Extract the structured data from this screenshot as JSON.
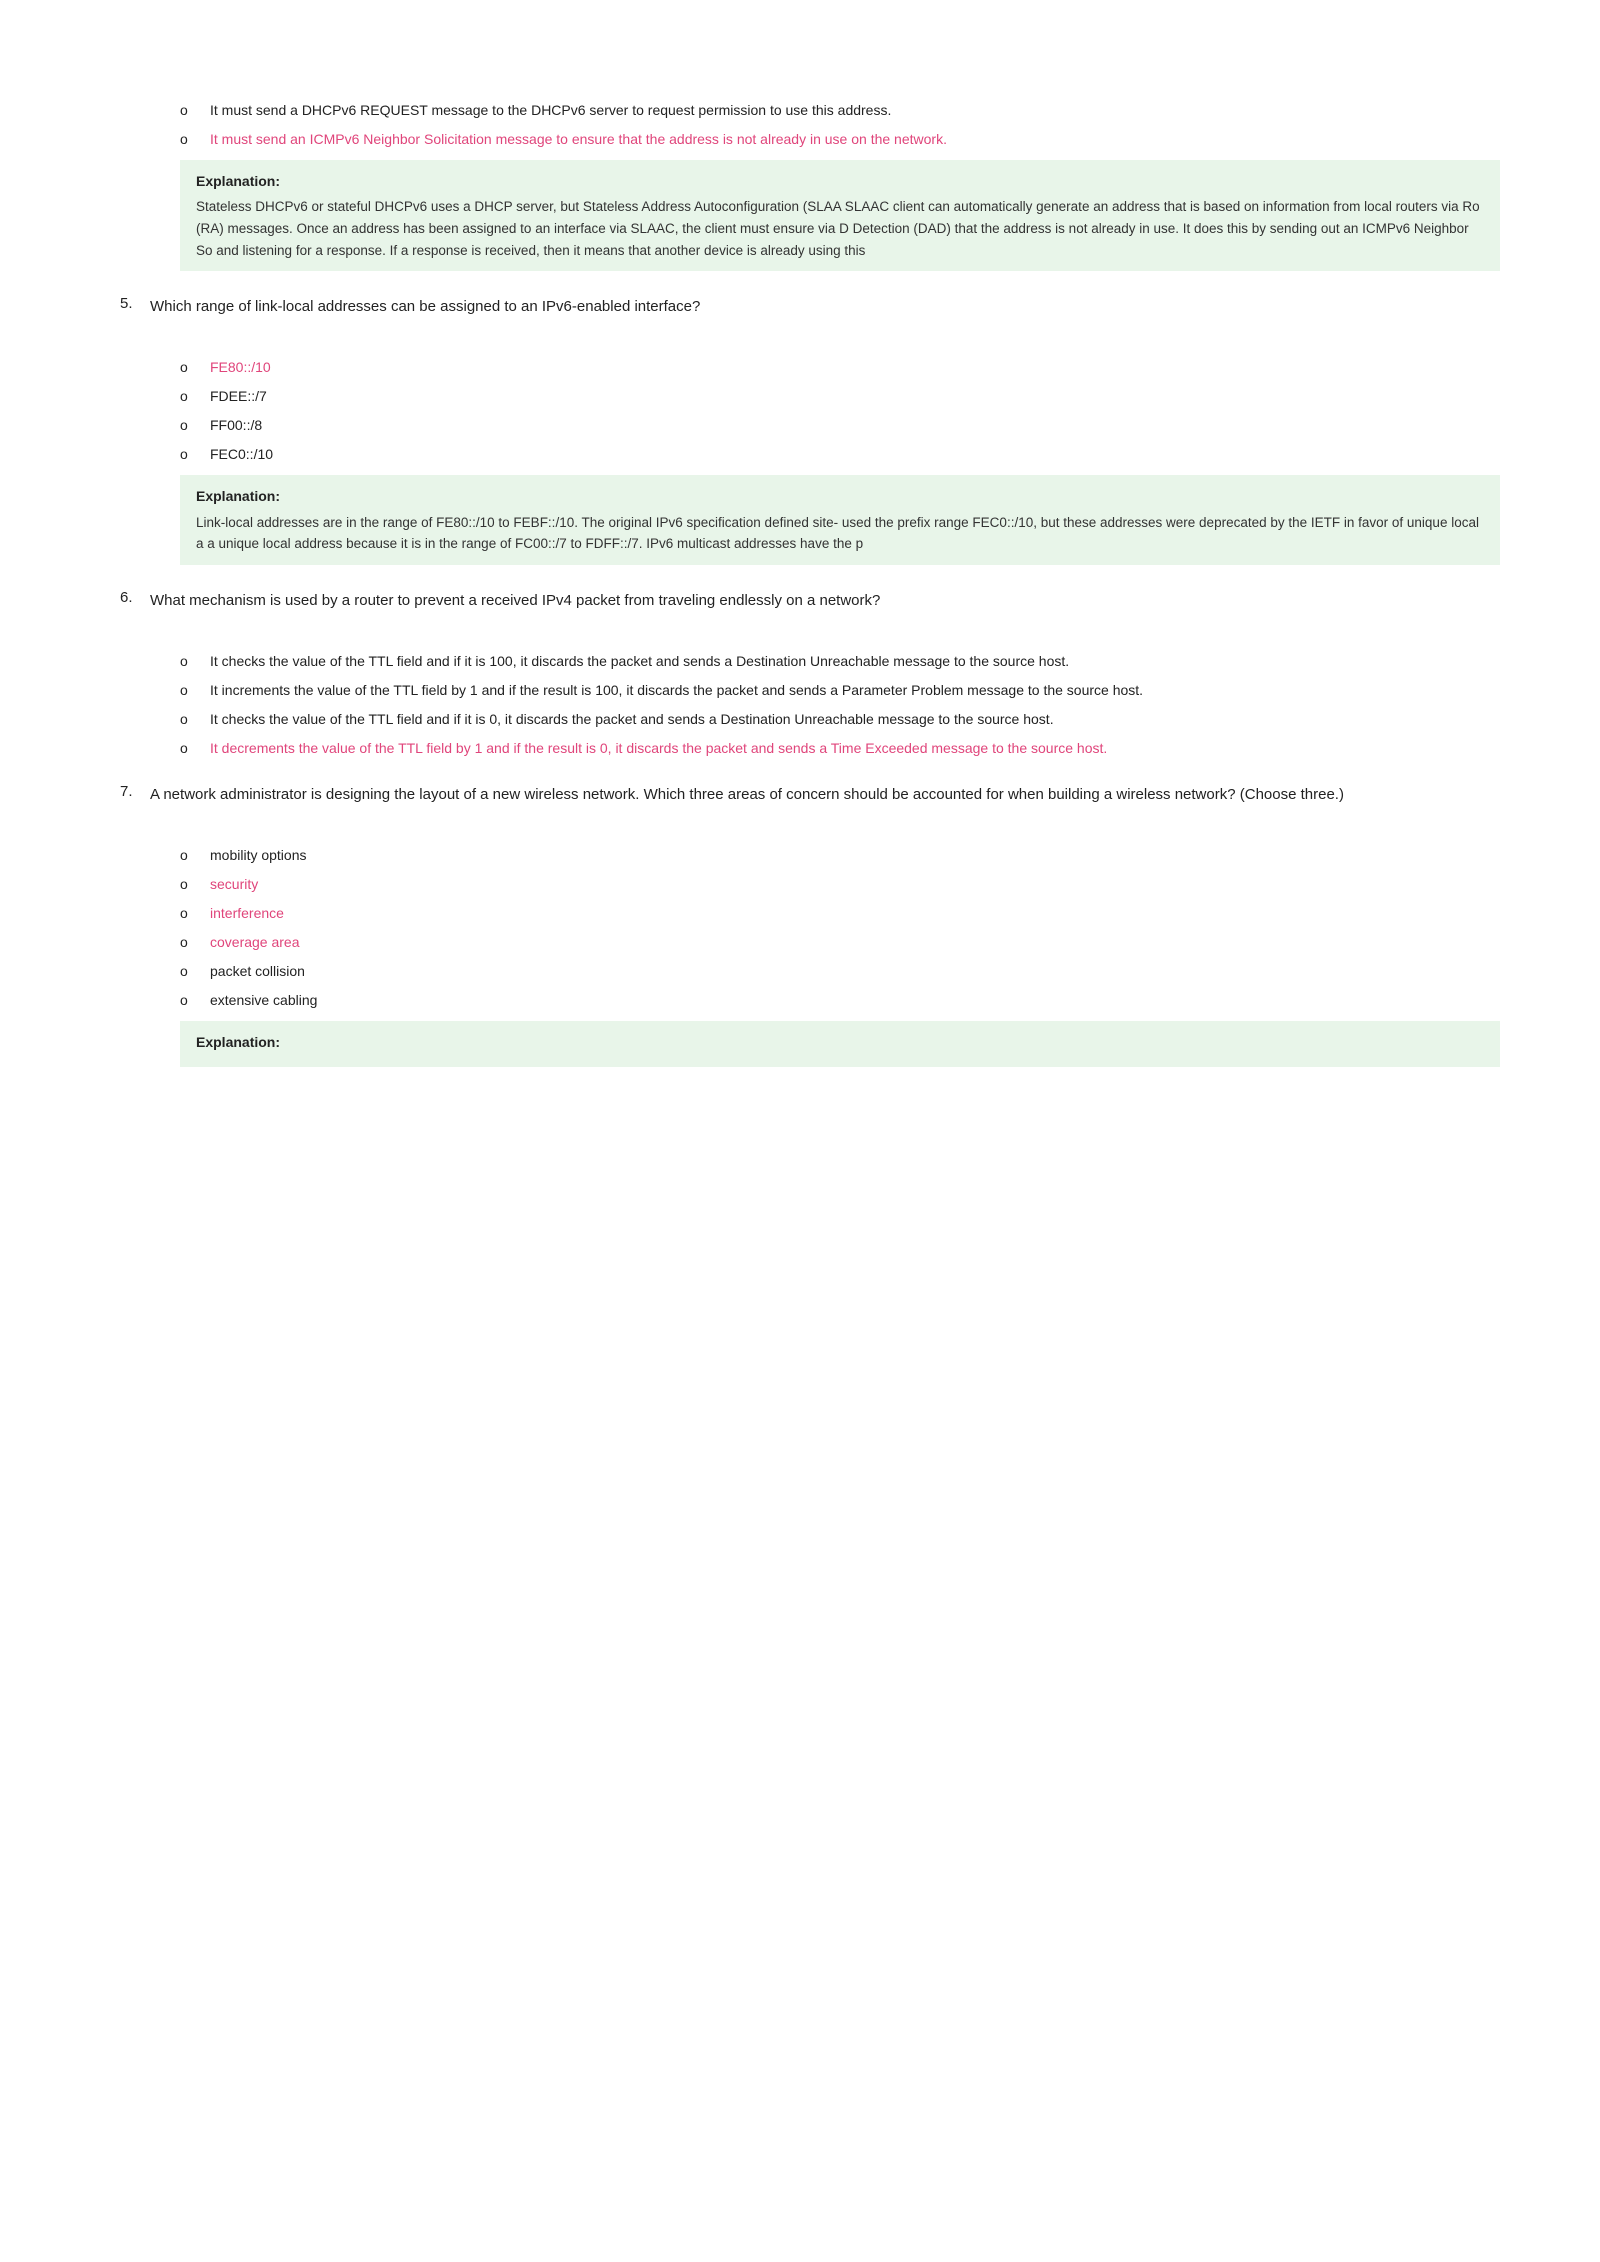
{
  "page": {
    "intro_bullets": [
      {
        "text": "It must send a DHCPv6 REQUEST message to the DHCPv6 server to request permission to use this address.",
        "is_answer": false
      },
      {
        "text": "It must send an ICMPv6 Neighbor Solicitation message to ensure that the address is not already in use on the network.",
        "is_answer": true
      }
    ],
    "intro_explanation": {
      "label": "Explanation:",
      "text": "Stateless DHCPv6 or stateful DHCPv6 uses a DHCP server, but Stateless Address Autoconfiguration (SLAA SLAAC client can automatically generate an address that is based on information from local routers via Ro (RA) messages. Once an address has been assigned to an interface via SLAAC, the client must ensure via D Detection (DAD) that the address is not already in use. It does this by sending out an ICMPv6 Neighbor So and listening for a response. If a response is received, then it means that another device is already using this"
    },
    "questions": [
      {
        "number": "5.",
        "text": "Which range of link-local addresses can be assigned to an IPv6-enabled interface?",
        "bullets": [
          {
            "text": "FE80::/10",
            "is_answer": true
          },
          {
            "text": "FDEE::/7",
            "is_answer": false
          },
          {
            "text": "FF00::/8",
            "is_answer": false
          },
          {
            "text": "FEC0::/10",
            "is_answer": false
          }
        ],
        "explanation": {
          "label": "Explanation:",
          "text": "Link-local addresses are in the range of FE80::/10 to FEBF::/10. The original IPv6 specification defined site- used the prefix range FEC0::/10, but these addresses were deprecated by the IETF in favor of unique local a a unique local address because it is in the range of FC00::/7 to FDFF::/7. IPv6 multicast addresses have the p"
        }
      },
      {
        "number": "6.",
        "text": "What mechanism is used by a router to prevent a received IPv4 packet from traveling endlessly on a network?",
        "bullets": [
          {
            "text": "It checks the value of the TTL field and if it is 100, it discards the packet and sends a Destination Unreachable message to the source host.",
            "is_answer": false
          },
          {
            "text": "It increments the value of the TTL field by 1 and if the result is 100, it discards the packet and sends a Parameter Problem message to the source host.",
            "is_answer": false
          },
          {
            "text": "It checks the value of the TTL field and if it is 0, it discards the packet and sends a Destination Unreachable message to the source host.",
            "is_answer": false
          },
          {
            "text": "It decrements the value of the TTL field by 1 and if the result is 0, it discards the packet and sends a Time Exceeded message to the source host.",
            "is_answer": true
          }
        ],
        "explanation": null
      },
      {
        "number": "7.",
        "text": "A network administrator is designing the layout of a new wireless network. Which three areas of concern should be accounted for when building a wireless network? (Choose three.)",
        "bullets": [
          {
            "text": "mobility options",
            "is_answer": false
          },
          {
            "text": "security",
            "is_answer": true
          },
          {
            "text": "interference",
            "is_answer": true
          },
          {
            "text": "coverage area",
            "is_answer": true
          },
          {
            "text": "packet collision",
            "is_answer": false
          },
          {
            "text": "extensive cabling",
            "is_answer": false
          }
        ],
        "explanation": {
          "label": "Explanation:",
          "text": ""
        }
      }
    ]
  }
}
